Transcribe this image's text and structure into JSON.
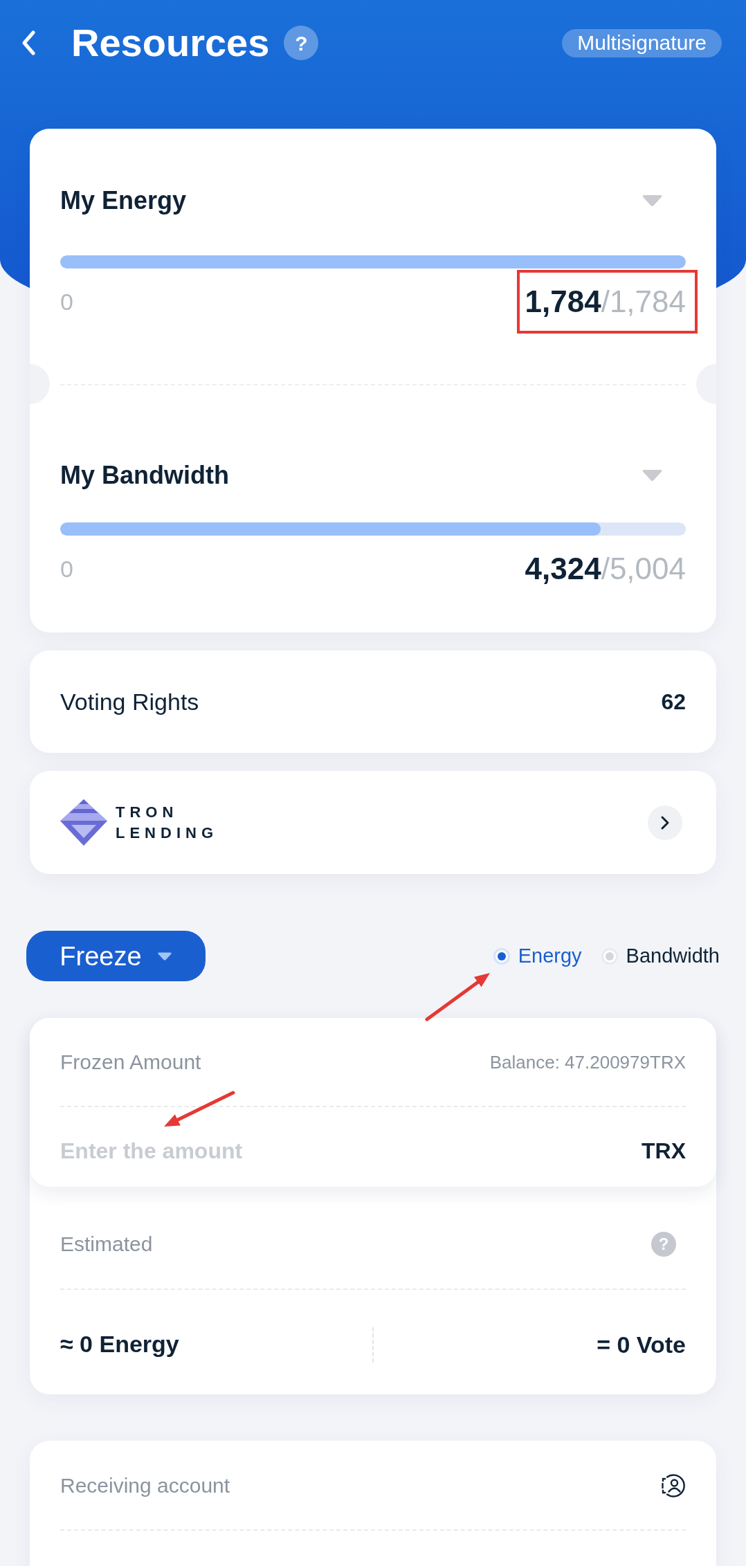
{
  "header": {
    "title": "Resources",
    "help": "?",
    "multisig_button": "Multisignature"
  },
  "resources": [
    {
      "name": "My Energy",
      "min": "0",
      "used": "1,784",
      "total": "/1,784",
      "level": 1,
      "boxed": true
    },
    {
      "name": "My Bandwidth",
      "min": "0",
      "used": "4,324",
      "total": "/5,004",
      "level": 0.864,
      "boxed": false
    }
  ],
  "voting_rights": {
    "label": "Voting Rights",
    "value": "62"
  },
  "lending_banner": {
    "logo_text": [
      "TRON",
      "LENDING"
    ]
  },
  "freeze": {
    "mode_button": "Freeze",
    "resource_options": [
      {
        "label": "Energy",
        "selected": true,
        "arrow": true
      },
      {
        "label": "Bandwidth",
        "selected": false,
        "arrow": false
      }
    ],
    "amount": {
      "label": "Frozen Amount",
      "balance": "Balance: 47.200979TRX",
      "placeholder": "Enter the amount",
      "unit": "TRX",
      "arrow": true
    },
    "estimated": {
      "label": "Estimated",
      "help": "?",
      "energy": "≈ 0 Energy",
      "votes": "= 0 Vote"
    }
  },
  "receiving_account": {
    "label": "Receiving account"
  }
}
